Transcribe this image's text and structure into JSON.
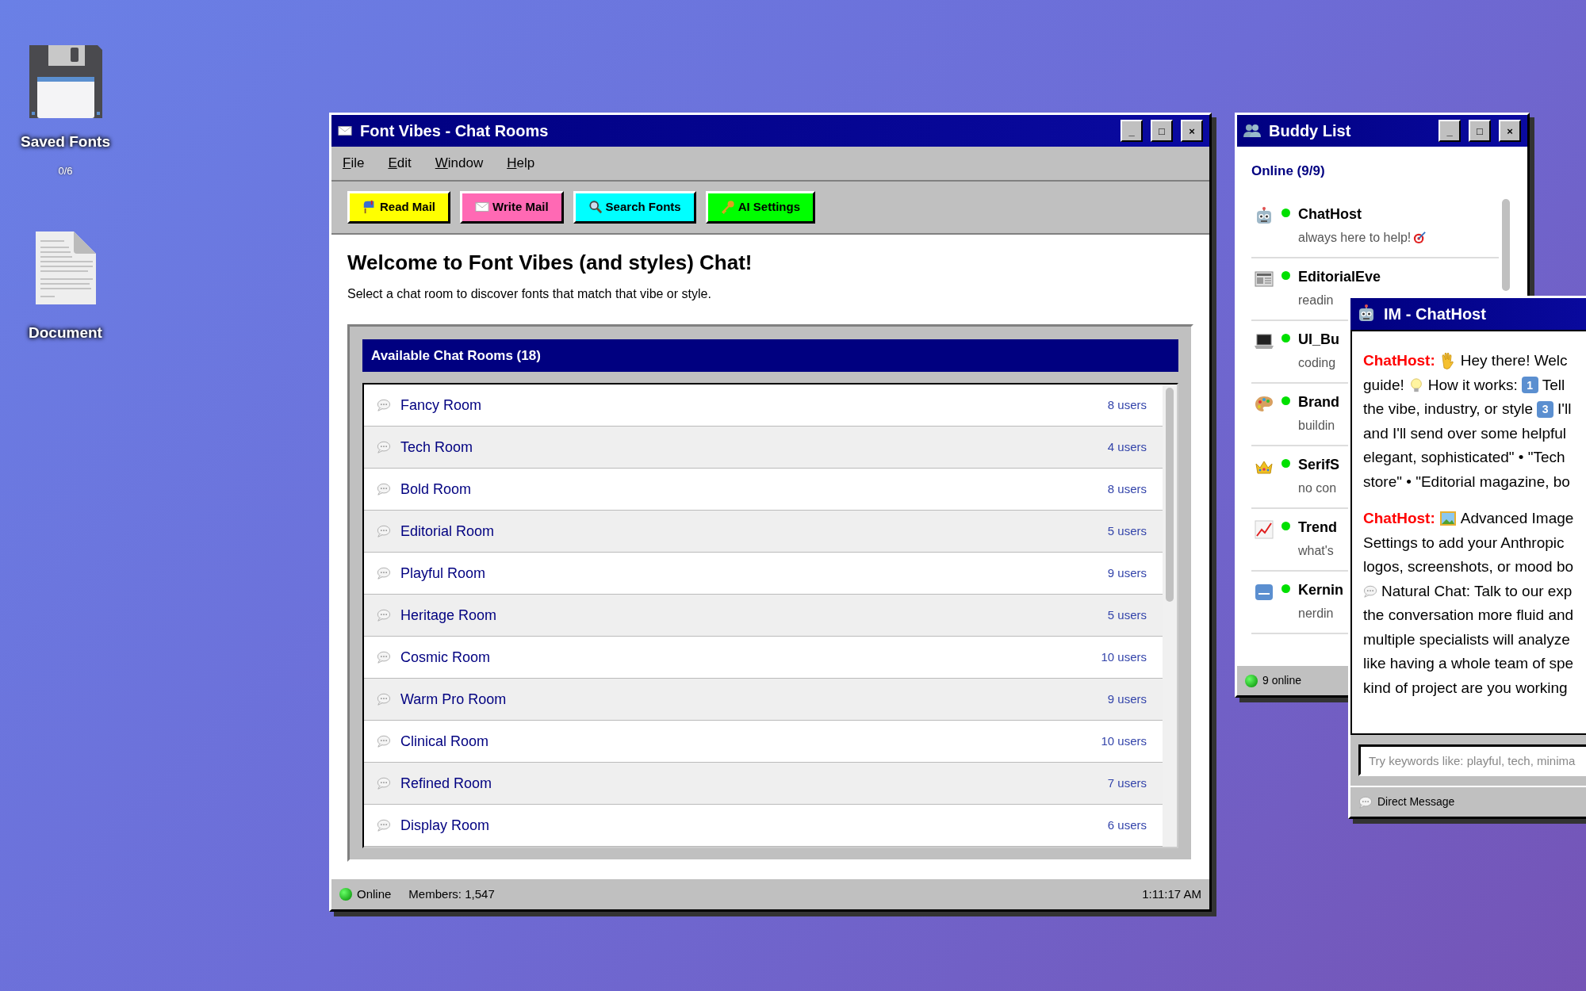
{
  "desktop_icons": [
    {
      "kind": "floppy",
      "label": "Saved Fonts",
      "count": "0/6"
    },
    {
      "kind": "document",
      "label": "Document"
    }
  ],
  "main_window": {
    "title": "Font Vibes - Chat Rooms",
    "controls": [
      "_",
      "□",
      "×"
    ],
    "menu": [
      "File",
      "Edit",
      "Window",
      "Help"
    ],
    "toolbar": [
      {
        "label": "Read Mail",
        "color": "#ffff00"
      },
      {
        "label": "Write Mail",
        "color": "#ff69b4"
      },
      {
        "label": "Search Fonts",
        "color": "#00ffff"
      },
      {
        "label": "AI Settings",
        "color": "#00ff00"
      }
    ],
    "heading": "Welcome to Font Vibes (and styles) Chat!",
    "subtitle": "Select a chat room to discover fonts that match that vibe or style.",
    "rooms_title": "Available Chat Rooms (18)",
    "rooms": [
      {
        "name": "Fancy Room",
        "users": "8 users"
      },
      {
        "name": "Tech Room",
        "users": "4 users"
      },
      {
        "name": "Bold Room",
        "users": "8 users"
      },
      {
        "name": "Editorial Room",
        "users": "5 users"
      },
      {
        "name": "Playful Room",
        "users": "9 users"
      },
      {
        "name": "Heritage Room",
        "users": "5 users"
      },
      {
        "name": "Cosmic Room",
        "users": "10 users"
      },
      {
        "name": "Warm Pro Room",
        "users": "9 users"
      },
      {
        "name": "Clinical Room",
        "users": "10 users"
      },
      {
        "name": "Refined Room",
        "users": "7 users"
      },
      {
        "name": "Display Room",
        "users": "6 users"
      }
    ],
    "status_bar": {
      "state": "Online",
      "members": "Members: 1,547",
      "time": "1:11:17 AM"
    }
  },
  "buddy_list": {
    "title": "Buddy List",
    "controls": [
      "_",
      "□",
      "×"
    ],
    "group": "Online (9/9)",
    "buddies": [
      {
        "name": "ChatHost",
        "status": "always here to help!",
        "online": true,
        "badge": true
      },
      {
        "name": "EditorialEve",
        "status": "readin",
        "online": true
      },
      {
        "name": "UI_Bu",
        "status": "coding",
        "online": true
      },
      {
        "name": "Brand",
        "status": "buildin",
        "online": true
      },
      {
        "name": "SerifS",
        "status": "no con",
        "online": true
      },
      {
        "name": "Trend",
        "status": "what's",
        "online": true
      },
      {
        "name": "Kernin",
        "status": "nerdin",
        "online": true
      }
    ],
    "footer": "9 online"
  },
  "im_window": {
    "title": "IM - ChatHost",
    "messages": [
      {
        "sender": "ChatHost:",
        "lines": [
          [
            {
              "kind": "wave"
            },
            {
              "text": "Hey there! Welc"
            }
          ],
          [
            {
              "text": "guide!"
            },
            {
              "kind": "bulb"
            },
            {
              "text": "How it works:"
            },
            {
              "kind": "keycap",
              "text": "1"
            },
            {
              "text": "Tell"
            }
          ],
          [
            {
              "text": "the vibe, industry, or style"
            },
            {
              "kind": "keycap",
              "text": "3"
            },
            {
              "text": "I'll"
            }
          ],
          [
            {
              "text": "and I'll send over some helpful"
            }
          ],
          [
            {
              "text": "elegant, sophisticated\" • \"Tech"
            }
          ],
          [
            {
              "text": "store\" • \"Editorial magazine, bo"
            }
          ]
        ]
      },
      {
        "sender": "ChatHost:",
        "lines": [
          [
            {
              "kind": "picture"
            },
            {
              "text": "Advanced Image"
            }
          ],
          [
            {
              "text": "Settings to add your Anthropic"
            }
          ],
          [
            {
              "text": "logos, screenshots, or mood bo"
            }
          ],
          [
            {
              "kind": "speech"
            },
            {
              "text": "Natural Chat: Talk to our exp"
            }
          ],
          [
            {
              "text": "the conversation more fluid and"
            }
          ],
          [
            {
              "text": "multiple specialists will analyze"
            }
          ],
          [
            {
              "text": "like having a whole team of spe"
            }
          ],
          [
            {
              "text": "kind of project are you working"
            }
          ]
        ]
      }
    ],
    "input": {
      "placeholder": "Try keywords like: playful, tech, minima"
    },
    "footer": "Direct Message"
  }
}
